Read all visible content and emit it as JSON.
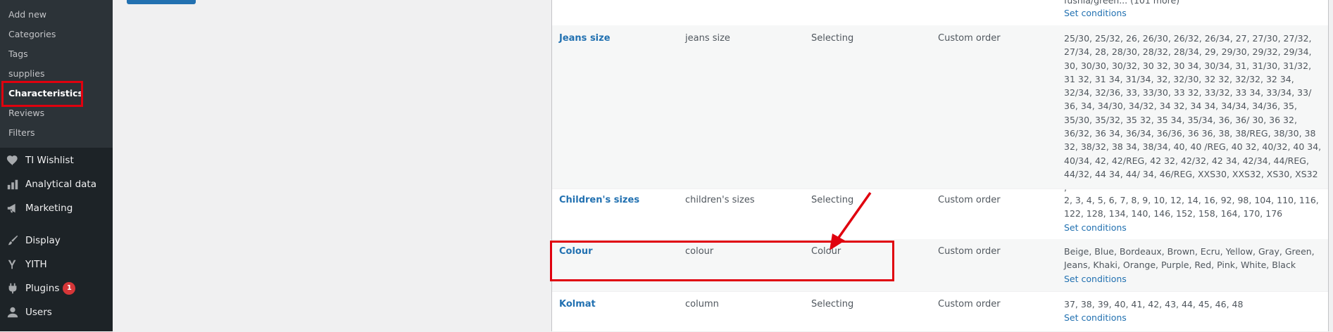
{
  "sidebar": {
    "submenu": [
      {
        "label": "Add new"
      },
      {
        "label": "Categories"
      },
      {
        "label": "Tags"
      },
      {
        "label": "supplies"
      },
      {
        "label": "Characteristics"
      },
      {
        "label": "Reviews"
      },
      {
        "label": "Filters"
      }
    ],
    "menu": [
      {
        "label": "TI Wishlist",
        "icon": "heart-icon"
      },
      {
        "label": "Analytical data",
        "icon": "bar-chart-icon"
      },
      {
        "label": "Marketing",
        "icon": "megaphone-icon"
      },
      {
        "label": "Display",
        "icon": "paintbrush-icon"
      },
      {
        "label": "YITH",
        "icon": "yith-icon"
      },
      {
        "label": "Plugins",
        "icon": "plugin-icon",
        "badge": "1"
      },
      {
        "label": "Users",
        "icon": "user-icon"
      }
    ]
  },
  "table": {
    "prev_row_text": "fushia/green... (101 more)",
    "prev_row_conditions": "Set conditions",
    "rows": [
      {
        "name": "Jeans size",
        "slug": "jeans size",
        "type": "Selecting",
        "order": "Custom order",
        "terms": "25/30, 25/32, 26, 26/30, 26/32, 26/34, 27, 27/30, 27/32, 27/34, 28, 28/30, 28/32, 28/34, 29, 29/30, 29/32, 29/34, 30, 30/30, 30/32, 30 32, 30 34, 30/34, 31, 31/30, 31/32, 31 32, 31 34, 31/34, 32, 32/30, 32 32, 32/32, 32 34, 32/34, 32/36, 33, 33/30, 33 32, 33/32, 33 34, 33/34, 33/ 36, 34, 34/30, 34/32, 34 32, 34 34, 34/34, 34/36, 35, 35/30, 35/32, 35 32, 35 34, 35/34, 36, 36/ 30, 36 32, 36/32, 36 34, 36/34, 36/36, 36 36, 38, 38/REG, 38/30, 38 32, 38/32, 38 34, 38/34, 40, 40 /REG, 40 32, 40/32, 40 34, 40/34, 42, 42/REG, 42 32, 42/32, 42 34, 42/34, 44/REG, 44/32, 44 34, 44/ 34, 46/REG, XXS30, XXS32, XS30, XS32",
        "extra": ","
      },
      {
        "name": "Children's sizes",
        "slug": "children's sizes",
        "type": "Selecting",
        "order": "Custom order",
        "terms": "2, 3, 4, 5, 6, 7, 8, 9, 10, 12, 14, 16, 92, 98, 104, 110, 116, 122, 128, 134, 140, 146, 152, 158, 164, 170, 176",
        "conditions": "Set conditions"
      },
      {
        "name": "Colour",
        "slug": "colour",
        "type": "Colour",
        "order": "Custom order",
        "terms": "Beige, Blue, Bordeaux, Brown, Ecru, Yellow, Gray, Green, Jeans, Khaki, Orange, Purple, Red, Pink, White, Black",
        "conditions": "Set conditions"
      },
      {
        "name": "Kolmat",
        "slug": "column",
        "type": "Selecting",
        "order": "Custom order",
        "terms": "37, 38, 39, 40, 41, 42, 43, 44, 45, 46, 48",
        "conditions": "Set conditions"
      }
    ]
  },
  "colors": {
    "highlight": "#e0010e",
    "link": "#2271b1",
    "sidebar": "#1d2327"
  }
}
